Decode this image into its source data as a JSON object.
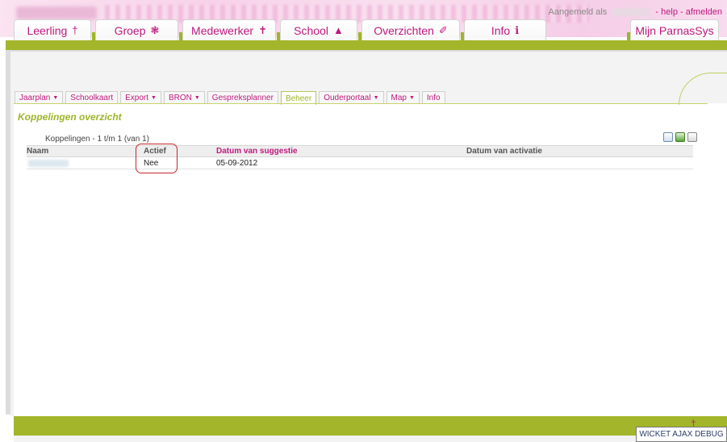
{
  "header": {
    "logged_in_prefix": "Aangemeld als",
    "help_label": "- help",
    "logout_label": "- afmelden"
  },
  "main_tabs": [
    {
      "label": "Leerling",
      "icon": "student-icon",
      "glyph": "†"
    },
    {
      "label": "Groep",
      "icon": "group-icon",
      "glyph": "❃"
    },
    {
      "label": "Medewerker",
      "icon": "staff-icon",
      "glyph": "✝"
    },
    {
      "label": "School",
      "icon": "school-icon",
      "glyph": "▲"
    },
    {
      "label": "Overzichten",
      "icon": "pencil-icon",
      "glyph": "✐"
    },
    {
      "label": "Info",
      "icon": "info-icon",
      "glyph": "ℹ"
    },
    {
      "label": "Mijn ParnasSys",
      "icon": "",
      "glyph": ""
    }
  ],
  "sub_tabs": [
    {
      "label": "Jaarplan",
      "dropdown": true
    },
    {
      "label": "Schoolkaart",
      "dropdown": false
    },
    {
      "label": "Export",
      "dropdown": true
    },
    {
      "label": "BRON",
      "dropdown": true
    },
    {
      "label": "Gespreksplanner",
      "dropdown": false
    },
    {
      "label": "Beheer",
      "dropdown": false,
      "active": true
    },
    {
      "label": "Ouderportaal",
      "dropdown": true
    },
    {
      "label": "Map",
      "dropdown": true
    },
    {
      "label": "Info",
      "dropdown": false
    }
  ],
  "page_title": "Koppelingen overzicht",
  "summary": "Koppelingen - 1 t/m 1 (van 1)",
  "export_icons": [
    "csv-export-icon",
    "excel-export-icon",
    "print-icon"
  ],
  "table": {
    "headers": [
      "Naam",
      "Actief",
      "Datum van suggestie",
      "Datum van activatie"
    ],
    "rows": [
      {
        "naam": "",
        "actief": "Nee",
        "datum_suggestie": "05-09-2012",
        "datum_activatie": ""
      }
    ]
  },
  "footer": {
    "debug_label": "WICKET AJAX DEBUG"
  },
  "colors": {
    "accent_pink": "#c0197e",
    "accent_olive": "#a3b52a",
    "highlight_red": "#c6262b"
  }
}
